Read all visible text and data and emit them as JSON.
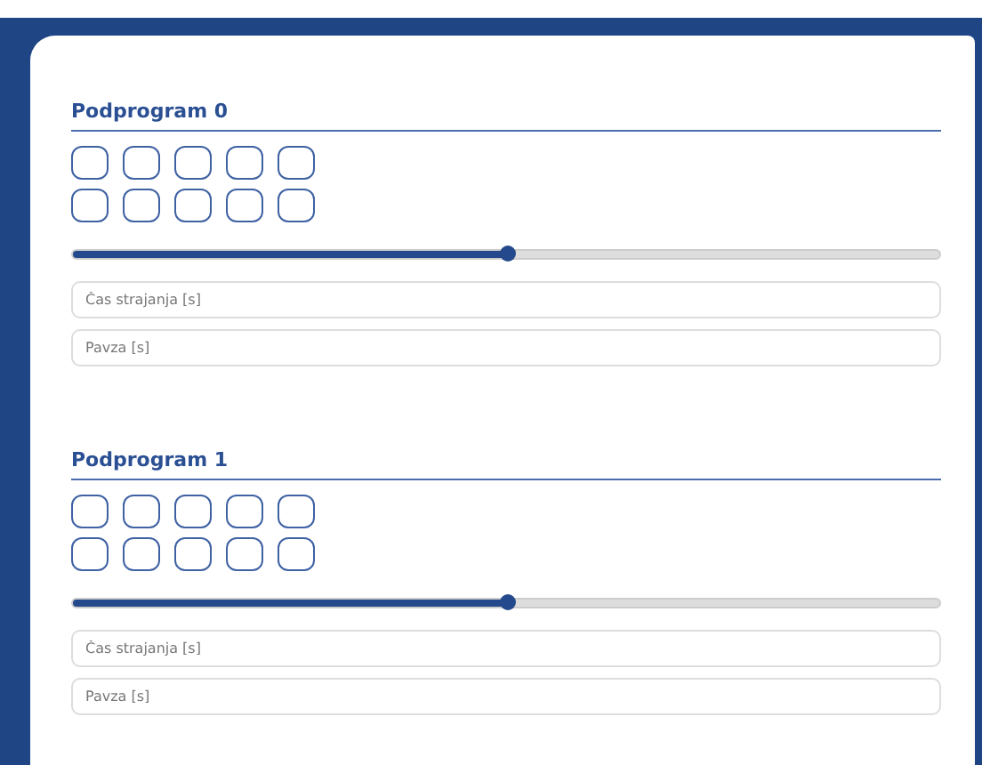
{
  "subprograms": [
    {
      "title": "Podprogram 0",
      "checkboxes": [
        {
          "checked": false
        },
        {
          "checked": false
        },
        {
          "checked": false
        },
        {
          "checked": false
        },
        {
          "checked": false
        },
        {
          "checked": false
        },
        {
          "checked": false
        },
        {
          "checked": false
        },
        {
          "checked": false
        },
        {
          "checked": false
        }
      ],
      "slider": {
        "level": 0.5
      },
      "fields": [
        {
          "placeholder": "Čas strajanja [s]"
        },
        {
          "placeholder": "Pavza [s]"
        }
      ]
    },
    {
      "title": "Podprogram 1",
      "checkboxes": [
        {
          "checked": false
        },
        {
          "checked": false
        },
        {
          "checked": false
        },
        {
          "checked": false
        },
        {
          "checked": false
        },
        {
          "checked": false
        },
        {
          "checked": false
        },
        {
          "checked": false
        },
        {
          "checked": false
        },
        {
          "checked": false
        }
      ],
      "slider": {
        "level": 0.5
      },
      "fields": [
        {
          "placeholder": "Čas strajanja [s]"
        },
        {
          "placeholder": "Pavza [s]"
        }
      ]
    }
  ]
}
